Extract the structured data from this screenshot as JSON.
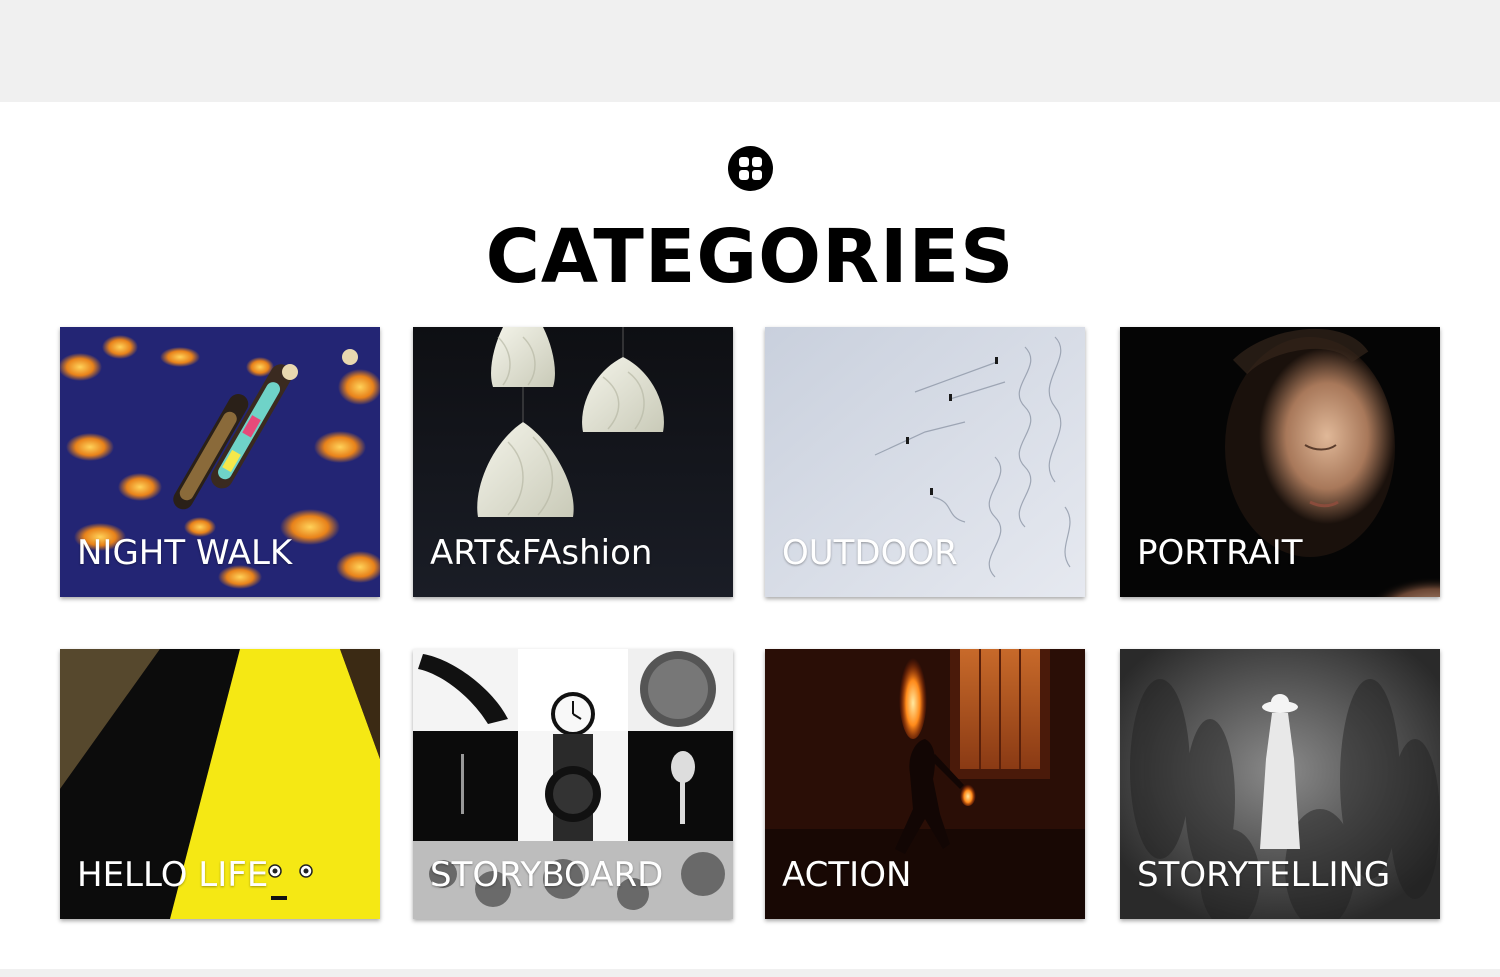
{
  "header": {
    "title": "CATEGORIES",
    "logo_icon": "grid-icon"
  },
  "categories": [
    {
      "label": "NIGHT WALK",
      "image": "floating-market-boats-night"
    },
    {
      "label": "ART&FAshion",
      "image": "white-pendant-lamps"
    },
    {
      "label": "OUTDOOR",
      "image": "skiers-on-snow-slope"
    },
    {
      "label": "PORTRAIT",
      "image": "boy-face-in-light"
    },
    {
      "label": "HELLO LIFE",
      "image": "yellow-light-wedge-with-face"
    },
    {
      "label": "STORYBOARD",
      "image": "black-white-collage-clock"
    },
    {
      "label": "ACTION",
      "image": "fire-breather-street"
    },
    {
      "label": "STORYTELLING",
      "image": "woman-in-white-hat-blurred-crowd"
    }
  ]
}
